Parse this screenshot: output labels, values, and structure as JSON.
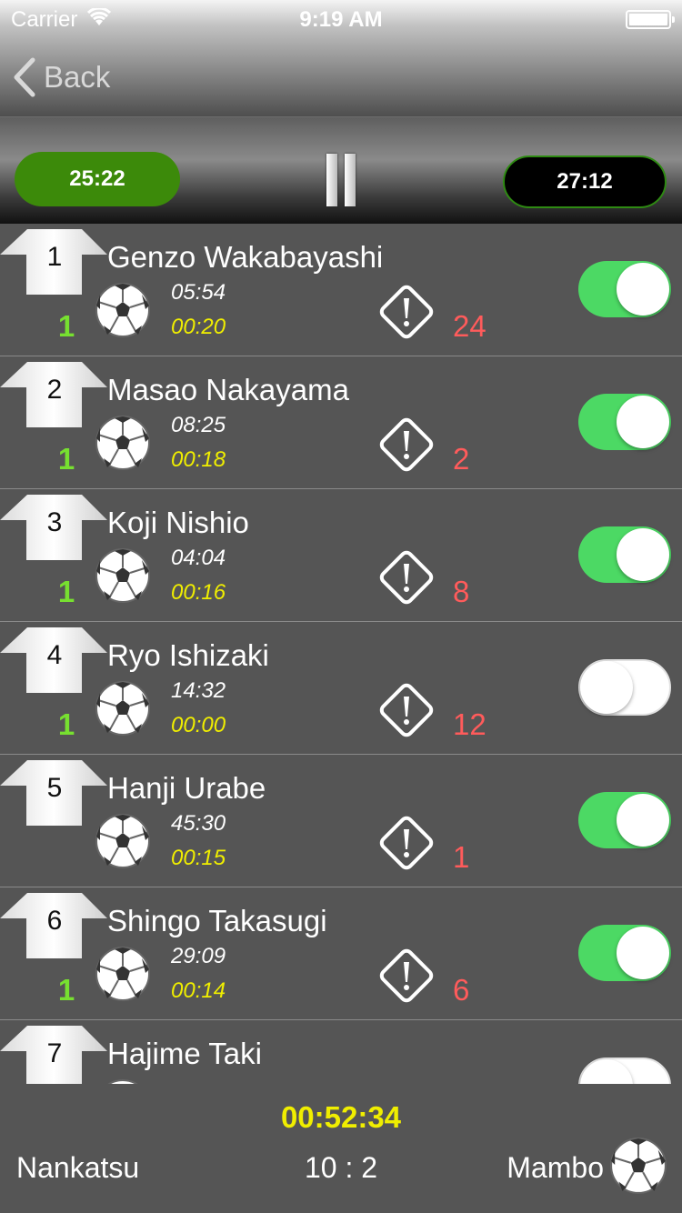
{
  "status": {
    "carrier": "Carrier",
    "time": "9:19 AM"
  },
  "nav": {
    "back_label": "Back"
  },
  "timers": {
    "left": "25:22",
    "right": "27:12"
  },
  "players": [
    {
      "number": "1",
      "name": "Genzo Wakabayashi",
      "count": "1",
      "time_total": "05:54",
      "time_current": "00:20",
      "fouls": "24",
      "active": true
    },
    {
      "number": "2",
      "name": "Masao Nakayama",
      "count": "1",
      "time_total": "08:25",
      "time_current": "00:18",
      "fouls": "2",
      "active": true
    },
    {
      "number": "3",
      "name": "Koji Nishio",
      "count": "1",
      "time_total": "04:04",
      "time_current": "00:16",
      "fouls": "8",
      "active": true
    },
    {
      "number": "4",
      "name": "Ryo Ishizaki",
      "count": "1",
      "time_total": "14:32",
      "time_current": "00:00",
      "fouls": "12",
      "active": false
    },
    {
      "number": "5",
      "name": "Hanji Urabe",
      "count": "",
      "time_total": "45:30",
      "time_current": "00:15",
      "fouls": "1",
      "active": true
    },
    {
      "number": "6",
      "name": "Shingo Takasugi",
      "count": "1",
      "time_total": "29:09",
      "time_current": "00:14",
      "fouls": "6",
      "active": true
    },
    {
      "number": "7",
      "name": "Hajime Taki",
      "count": "",
      "time_total": "",
      "time_current": "",
      "fouls": "",
      "active": false
    }
  ],
  "footer": {
    "match_time": "00:52:34",
    "home_team": "Nankatsu",
    "score": "10 : 2",
    "away_team": "Mambo"
  },
  "colors": {
    "toggle_on": "#4cd964",
    "count": "#77e030",
    "current_time": "#f0ee00",
    "fouls": "#ff5b5b",
    "timer_green": "#3c8a0a"
  }
}
